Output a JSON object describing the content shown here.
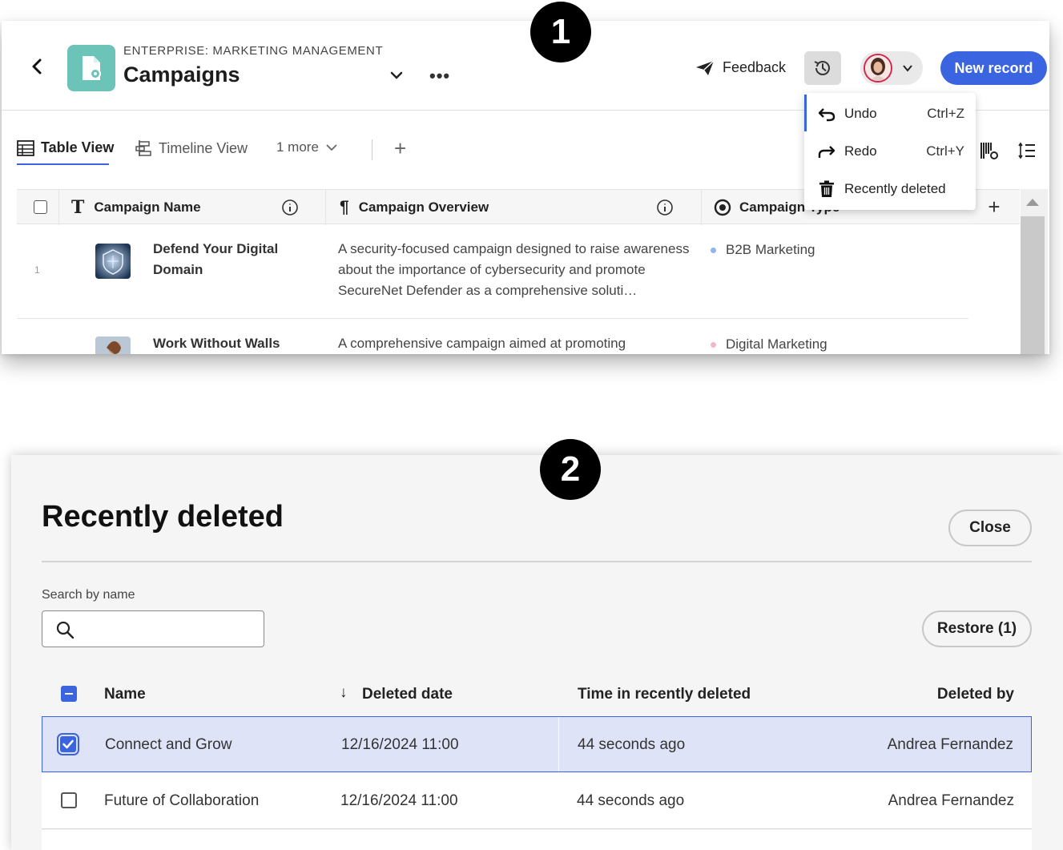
{
  "callouts": {
    "one": "1",
    "two": "2"
  },
  "header": {
    "workspace": "ENTERPRISE: MARKETING MANAGEMENT",
    "title": "Campaigns",
    "more": "•••",
    "feedback_label": "Feedback",
    "new_record_label": "New record"
  },
  "views": {
    "table": "Table View",
    "timeline": "Timeline View",
    "more": "1 more",
    "add": "+"
  },
  "history_menu": {
    "items": [
      {
        "label": "Undo",
        "shortcut": "Ctrl+Z",
        "icon": "undo-icon"
      },
      {
        "label": "Redo",
        "shortcut": "Ctrl+Y",
        "icon": "redo-icon"
      },
      {
        "label": "Recently deleted",
        "shortcut": "",
        "icon": "trash-icon"
      }
    ]
  },
  "table": {
    "columns": [
      "Campaign Name",
      "Campaign Overview",
      "Campaign Type"
    ],
    "add_column": "+",
    "rows": [
      {
        "num": "1",
        "name": "Defend Your Digital Domain",
        "overview": "A security-focused campaign designed to raise awareness about the importance of cybersecurity and promote SecureNet Defender as a comprehensive soluti…",
        "type": "B2B Marketing",
        "type_color": "#8fb4ee"
      },
      {
        "num": "",
        "name": "Work Without Walls",
        "overview": "A comprehensive campaign aimed at promoting",
        "type": "Digital Marketing",
        "type_color": "#f0b8c8"
      }
    ]
  },
  "dialog": {
    "title": "Recently deleted",
    "close_label": "Close",
    "search_label": "Search by name",
    "search_value": "",
    "search_placeholder": "",
    "restore_label": "Restore (1)",
    "columns": {
      "name": "Name",
      "sort_arrow": "↓",
      "deleted_date": "Deleted date",
      "time": "Time in recently deleted",
      "deleted_by": "Deleted by"
    },
    "rows": [
      {
        "name": "Connect and Grow",
        "date": "12/16/2024 11:00",
        "time": "44 seconds ago",
        "by": "Andrea Fernandez",
        "checked": true
      },
      {
        "name": "Future of Collaboration",
        "date": "12/16/2024 11:00",
        "time": "44 seconds ago",
        "by": "Andrea Fernandez",
        "checked": false
      }
    ]
  },
  "colors": {
    "accent": "#3a64e0",
    "app_icon": "#6cc3b8",
    "avatar_ring": "#d5264e"
  }
}
